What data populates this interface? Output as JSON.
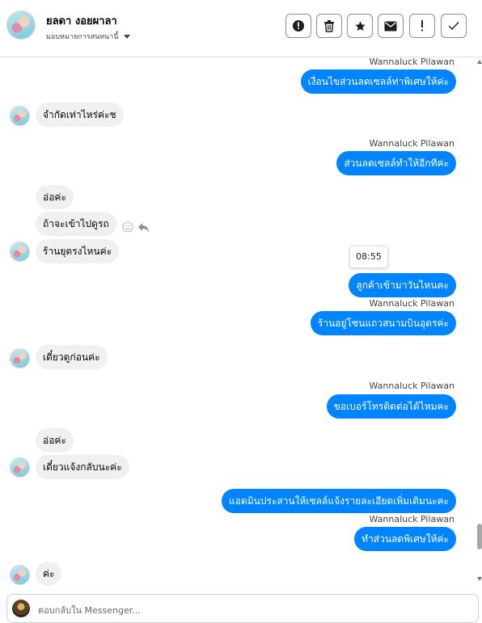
{
  "header": {
    "contact_name": "ยลดา งอยผาลา",
    "assign_label": "มอบหมายการสนทนานี้",
    "tools": [
      {
        "icon": "alert-circle-icon",
        "label": "mark-spam"
      },
      {
        "icon": "trash-icon",
        "label": "delete"
      },
      {
        "icon": "star-icon",
        "label": "star"
      },
      {
        "icon": "envelope-icon",
        "label": "mark-unread"
      },
      {
        "icon": "exclamation-icon",
        "label": "follow-up"
      },
      {
        "icon": "check-icon",
        "label": "done"
      }
    ]
  },
  "messages": [
    {
      "dir": "out",
      "sender": "Wannaluck Pilawan",
      "text": "เงื่อนไขส่วนลดเซลล์ท่าพิเศษให้ค่ะ"
    },
    {
      "dir": "in",
      "text": "จำกัดเท่าไหร่ค่ะช"
    },
    {
      "dir": "out",
      "sender": "Wannaluck Pilawan",
      "text": "ส่วนลดเซลล์ทำให้อีกทีค่ะ"
    },
    {
      "dir": "in",
      "text": "อ่อค่ะ"
    },
    {
      "dir": "in",
      "text": "ถ้าจะเข้าไปดูรถ"
    },
    {
      "dir": "in",
      "text": "ร้านยุตรงไหนค่ะ"
    },
    {
      "dir": "out",
      "text": "ลูกค้าเข้ามาวันไหนคะ"
    },
    {
      "dir": "out",
      "sender": "Wannaluck Pilawan",
      "text": "ร้านอยู่โซนแถวสนามบินอุดรค่ะ"
    },
    {
      "dir": "in",
      "text": "เดี๋ยวดูก่อนค่ะ"
    },
    {
      "dir": "out",
      "sender": "Wannaluck Pilawan",
      "text": "ขอเบอร์โทรติดต่อได้ไหมคะ"
    },
    {
      "dir": "in",
      "text": "อ่อค่ะ"
    },
    {
      "dir": "in",
      "text": "เดี๋ยวแจ้งกลับนะค่ะ"
    },
    {
      "dir": "out",
      "text": "แอดมินประสานให้เซลล์แจ้งรายละเอียดเพิ่มเติมนะคะ"
    },
    {
      "dir": "out",
      "sender": "Wannaluck Pilawan",
      "text": "ทำส่วนลดพิเศษให้ค่ะ"
    },
    {
      "dir": "in",
      "text": "ค่ะ"
    }
  ],
  "tooltip_time": "08:55",
  "composer": {
    "placeholder": "ตอบกลับใน Messenger..."
  },
  "colors": {
    "outgoing_bubble": "#0084ff",
    "incoming_bubble": "#f0f0f0"
  }
}
